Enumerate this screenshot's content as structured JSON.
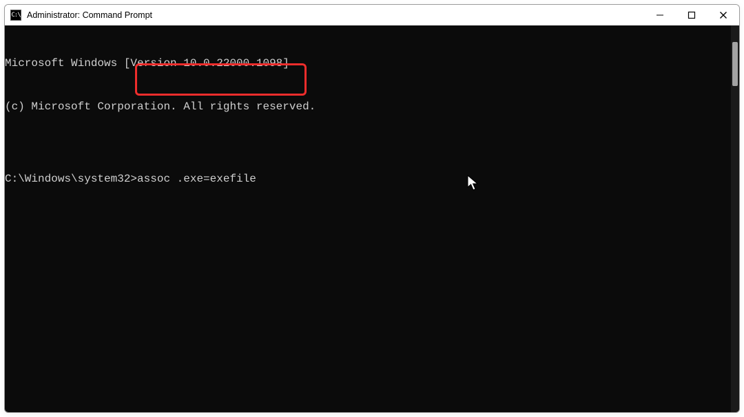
{
  "titlebar": {
    "icon_glyph": "C:\\",
    "title": "Administrator: Command Prompt",
    "buttons": {
      "minimize": "minimize",
      "maximize": "maximize",
      "close": "close"
    }
  },
  "console": {
    "line1": "Microsoft Windows [Version 10.0.22000.1098]",
    "line2": "(c) Microsoft Corporation. All rights reserved.",
    "blank": "",
    "prompt": "C:\\Windows\\system32>",
    "command": "assoc .exe=exefile"
  },
  "annotations": {
    "highlight_target": "command-input"
  }
}
